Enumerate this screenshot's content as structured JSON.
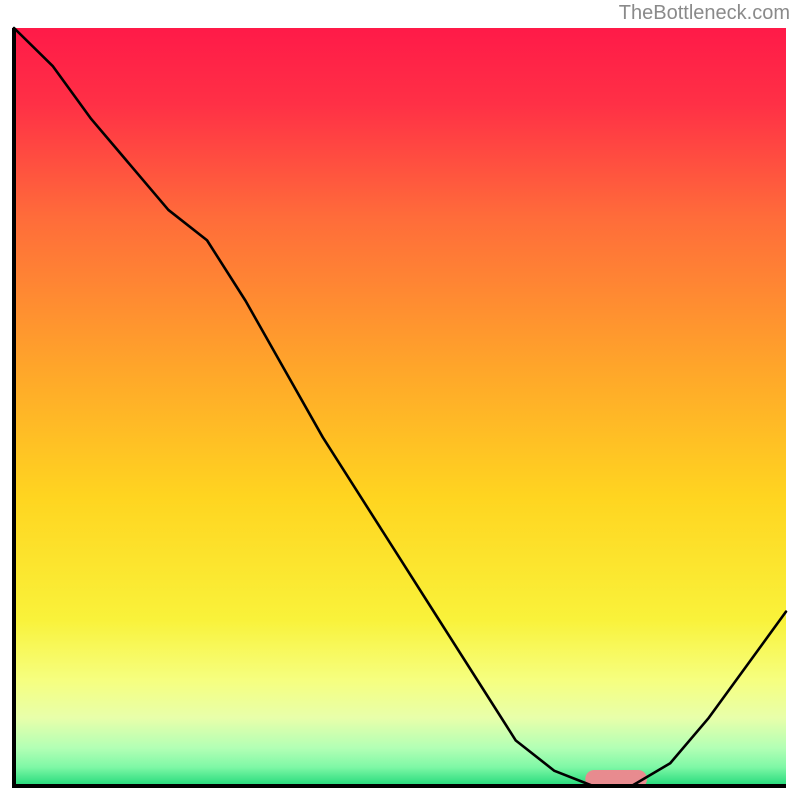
{
  "watermark": "TheBottleneck.com",
  "chart_data": {
    "type": "line",
    "title": "",
    "xlabel": "",
    "ylabel": "",
    "xlim": [
      0,
      100
    ],
    "ylim": [
      0,
      100
    ],
    "grid": false,
    "series": [
      {
        "name": "bottleneck-curve",
        "x": [
          0,
          5,
          10,
          15,
          20,
          25,
          30,
          35,
          40,
          45,
          50,
          55,
          60,
          65,
          70,
          75,
          80,
          85,
          90,
          95,
          100
        ],
        "y": [
          100,
          95,
          88,
          82,
          76,
          72,
          64,
          55,
          46,
          38,
          30,
          22,
          14,
          6,
          2,
          0,
          0,
          3,
          9,
          16,
          23
        ]
      }
    ],
    "marker": {
      "name": "optimal-marker",
      "x_start": 74,
      "x_end": 82,
      "y": 0,
      "color": "#e88b8f"
    },
    "gradient_stops": [
      {
        "offset": 0.0,
        "color": "#ff1a48"
      },
      {
        "offset": 0.1,
        "color": "#ff3046"
      },
      {
        "offset": 0.25,
        "color": "#ff6c3a"
      },
      {
        "offset": 0.45,
        "color": "#ffa62a"
      },
      {
        "offset": 0.62,
        "color": "#ffd520"
      },
      {
        "offset": 0.78,
        "color": "#f9f23a"
      },
      {
        "offset": 0.86,
        "color": "#f6ff7f"
      },
      {
        "offset": 0.91,
        "color": "#e8ffaa"
      },
      {
        "offset": 0.95,
        "color": "#b2ffb5"
      },
      {
        "offset": 0.975,
        "color": "#7ff8a6"
      },
      {
        "offset": 1.0,
        "color": "#22d97a"
      }
    ],
    "axis_color": "#000000",
    "curve_color": "#000000",
    "curve_width": 2.6
  }
}
